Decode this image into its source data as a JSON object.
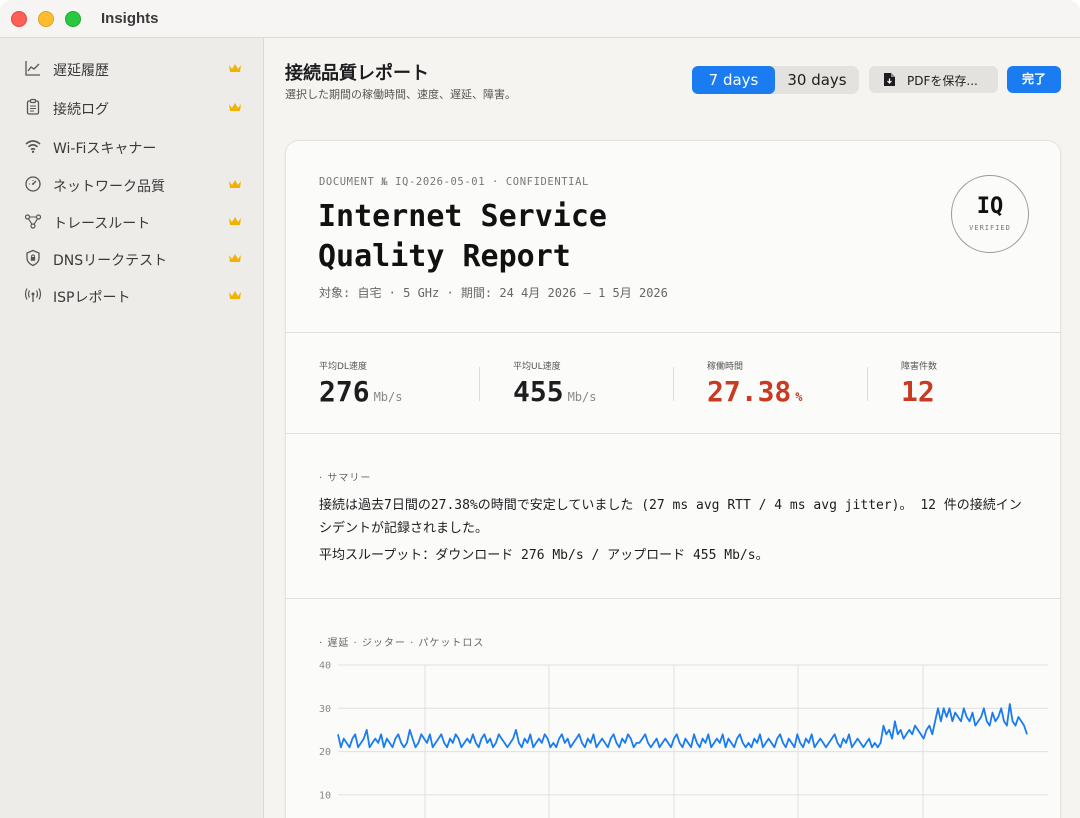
{
  "window": {
    "title": "Insights"
  },
  "sidebar": {
    "items": [
      {
        "label": "遅延履歴",
        "icon": "line-chart-icon",
        "premium": true
      },
      {
        "label": "接続ログ",
        "icon": "clipboard-icon",
        "premium": true
      },
      {
        "label": "Wi-Fiスキャナー",
        "icon": "wifi-icon",
        "premium": false
      },
      {
        "label": "ネットワーク品質",
        "icon": "gauge-icon",
        "premium": true
      },
      {
        "label": "トレースルート",
        "icon": "nodes-icon",
        "premium": true
      },
      {
        "label": "DNSリークテスト",
        "icon": "shield-icon",
        "premium": true
      },
      {
        "label": "ISPレポート",
        "icon": "antenna-icon",
        "premium": true
      }
    ]
  },
  "header": {
    "title": "接続品質レポート",
    "subtitle": "選択した期間の稼働時間、速度、遅延、障害。",
    "range_options": [
      "7 days",
      "30 days"
    ],
    "selected_range": "7 days",
    "pdf_label": "PDFを保存...",
    "done_label": "完了"
  },
  "report": {
    "doc_id": "DOCUMENT № IQ-2026-05-01 · CONFIDENTIAL",
    "title_line1": "Internet Service",
    "title_line2": "Quality Report",
    "meta": "対象: 自宅 · 5 GHz  ·  期間: 24 4月 2026 — 1 5月 2026",
    "seal_main": "IQ",
    "seal_sub": "VERIFIED",
    "stats": [
      {
        "label": "平均DL速度",
        "value": "276",
        "unit": "Mb/s",
        "alert": false
      },
      {
        "label": "平均UL速度",
        "value": "455",
        "unit": "Mb/s",
        "alert": false
      },
      {
        "label": "稼働時間",
        "value": "27.38",
        "unit": "%",
        "alert": true
      },
      {
        "label": "障害件数",
        "value": "12",
        "unit": "",
        "alert": true
      }
    ],
    "summary_label": "· サマリー",
    "summary_p1": "接続は過去7日間の27.38%の時間で安定していました (27 ms avg RTT / 4 ms avg jitter)。 12 件の接続インシデントが記録されました。",
    "summary_p2": "平均スループット：ダウンロード 276 Mb/s / アップロード 455 Mb/s。",
    "chart_label": "·  遅延  ·  ジッター  ·  パケットロス"
  },
  "colors": {
    "accent": "#1a7cf0",
    "alert": "#c83a22",
    "crown": "#f0b400",
    "series_latency": "#1a7cf0"
  },
  "chart_data": {
    "type": "line",
    "yticks": [
      40,
      30,
      20,
      10
    ],
    "ylim": [
      10,
      40
    ],
    "series": [
      {
        "values": [
          24,
          21,
          23,
          22,
          21,
          23,
          24,
          21,
          22,
          23,
          25,
          21,
          22,
          23,
          22,
          24,
          21,
          23,
          22,
          21,
          23,
          24,
          22,
          21,
          22,
          25,
          23,
          21,
          22,
          24,
          23,
          22,
          24,
          21,
          22,
          23,
          24,
          22,
          21,
          23,
          22,
          24,
          23,
          21,
          22,
          23,
          22,
          24,
          22,
          21,
          23,
          24,
          22,
          23,
          21,
          22,
          24,
          23,
          22,
          21,
          22,
          23,
          25,
          22,
          21,
          23,
          22,
          24,
          21,
          22,
          23,
          22,
          24,
          23,
          21,
          22,
          21,
          23,
          24,
          22,
          23,
          21,
          22,
          23,
          24,
          22,
          21,
          23,
          22,
          24,
          21,
          22,
          23,
          22,
          21,
          23,
          24,
          22,
          21,
          23,
          22,
          24,
          23,
          21,
          22,
          22,
          23,
          24,
          22,
          21,
          22,
          23,
          21,
          22,
          23,
          22,
          21,
          23,
          24,
          22,
          21,
          23,
          22,
          21,
          24,
          22,
          21,
          23,
          22,
          24,
          21,
          22,
          23,
          22,
          24,
          21,
          23,
          22,
          21,
          23,
          24,
          22,
          21,
          22,
          21,
          23,
          22,
          24,
          21,
          22,
          23,
          22,
          21,
          23,
          24,
          22,
          21,
          23,
          22,
          21,
          24,
          22,
          21,
          23,
          22,
          24,
          21,
          22,
          23,
          22,
          21,
          22,
          23,
          24,
          22,
          21,
          23,
          22,
          24,
          21,
          22,
          23,
          22,
          21,
          22,
          23,
          21,
          22,
          21,
          22,
          26,
          24,
          25,
          23,
          27,
          24,
          25,
          23,
          24,
          25,
          24,
          26,
          25,
          24,
          23,
          25,
          26,
          24,
          27,
          30,
          27,
          30,
          28,
          30,
          27,
          29,
          28,
          27,
          30,
          28,
          27,
          29,
          26,
          27,
          28,
          30,
          27,
          26,
          29,
          27,
          28,
          30,
          27,
          26,
          31,
          27,
          26,
          28,
          27,
          26,
          24
        ]
      }
    ]
  }
}
